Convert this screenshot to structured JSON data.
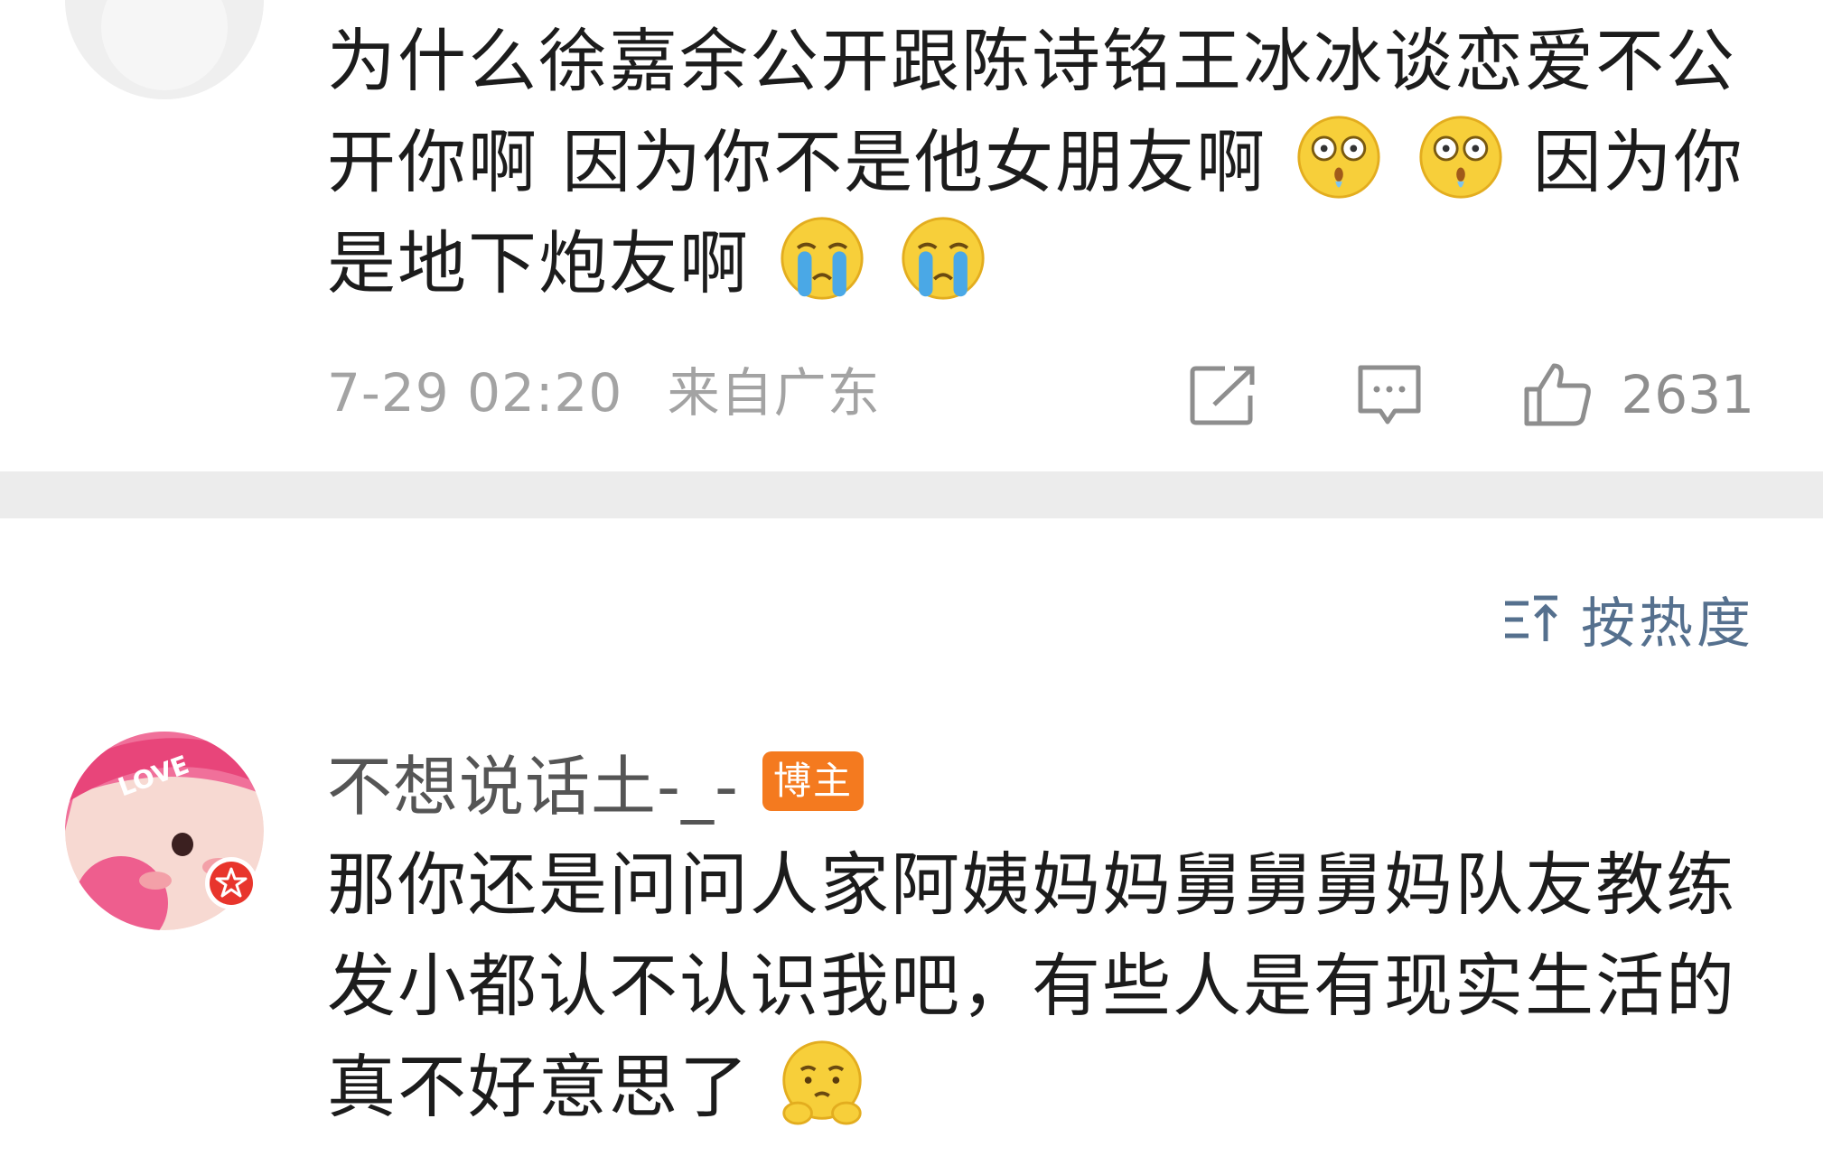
{
  "comment1": {
    "text_line1": "为什么徐嘉余公开跟陈诗铭王冰冰谈恋爱不公",
    "text_line2": "开你啊 因为你不是他女朋友啊",
    "text_line2_tail": "因为你",
    "text_line3": "是地下炮友啊",
    "timestamp": "7-29 02:20",
    "location": "来自广东",
    "like_count": "2631",
    "icons": {
      "share": "share-icon",
      "comment": "comment-icon",
      "like": "thumbs-up-icon",
      "emoji_surprised": "surprised-face-emoji",
      "emoji_crying": "crying-face-emoji"
    }
  },
  "sort": {
    "label": "按热度",
    "icon": "sort-icon"
  },
  "comment2": {
    "username": "不想说话土-_-",
    "badge": "博主",
    "text_line1": "那你还是问问人家阿姨妈妈舅舅舅妈队友教练",
    "text_line2": "发小都认不认识我吧，有些人是有现实生活的",
    "text_line3": "真不好意思了",
    "icons": {
      "emoji": "pleading-face-emoji",
      "verified": "verified-badge-icon"
    },
    "avatar_text": "LOVE"
  },
  "colors": {
    "link_blue": "#55708e",
    "badge_orange": "#f47a1f",
    "meta_gray": "#a3a3a3",
    "divider": "#ececec"
  }
}
